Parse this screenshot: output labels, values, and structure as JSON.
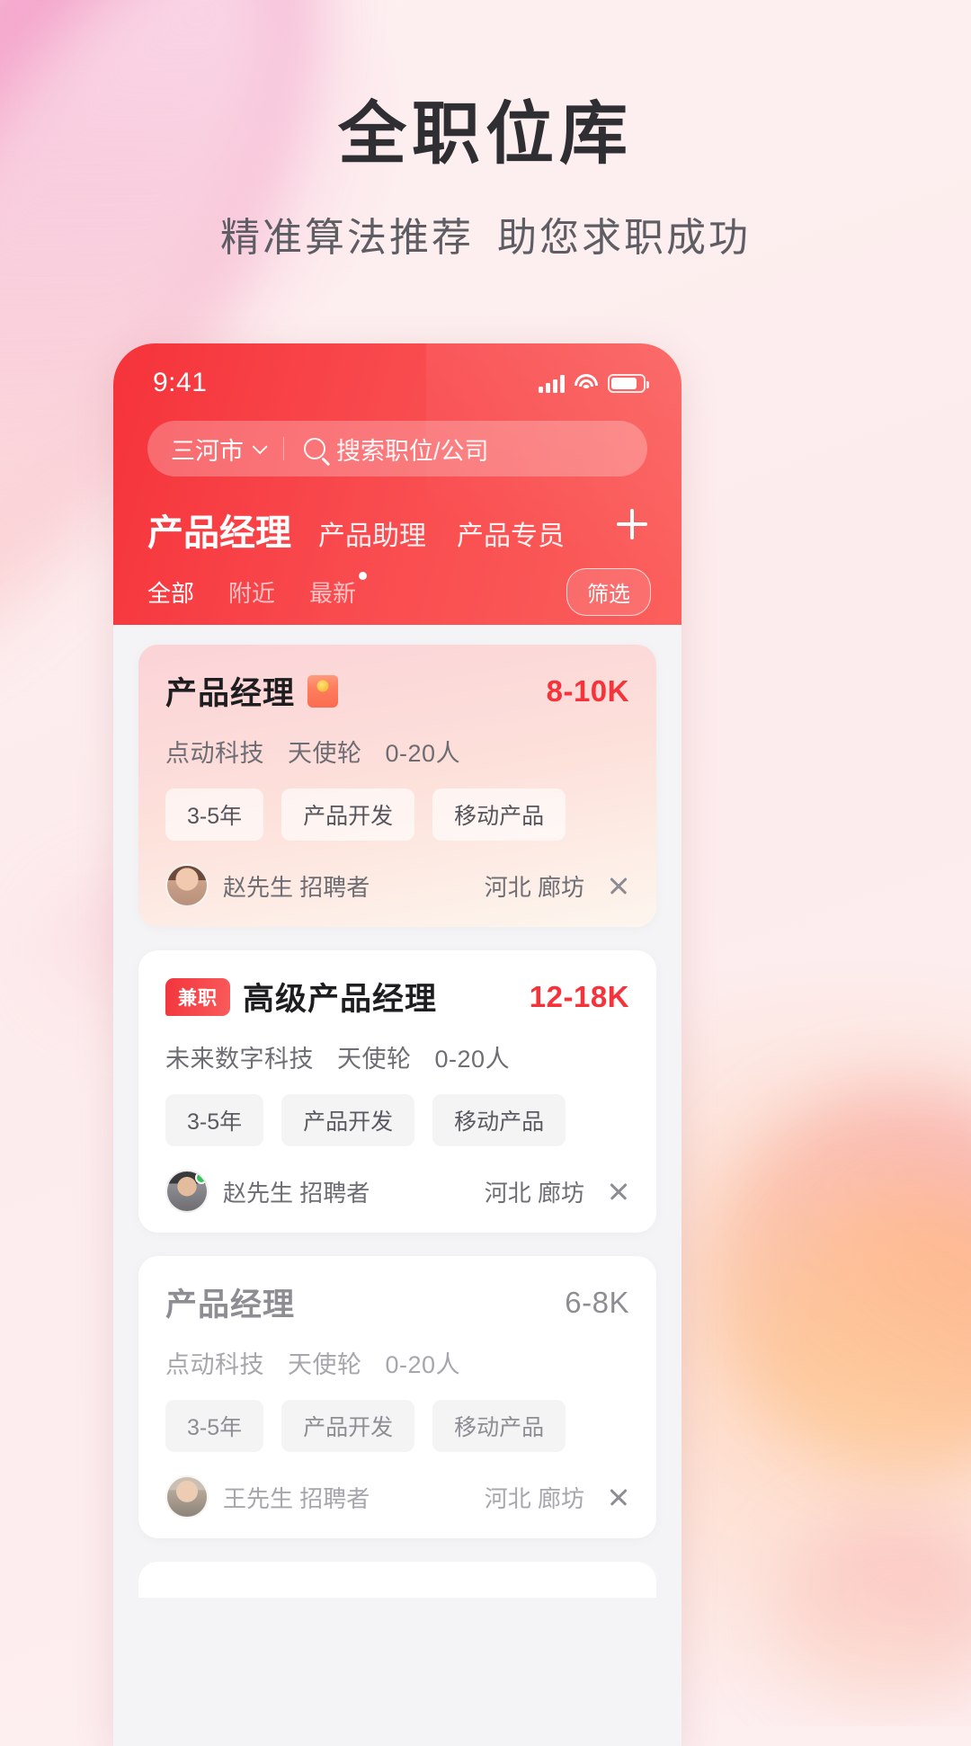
{
  "promo": {
    "title": "全职位库",
    "subtitle_left": "精准算法推荐",
    "subtitle_right": "助您求职成功"
  },
  "phone": {
    "status_bar": {
      "time": "9:41",
      "signal_icon": "signal-bars-icon",
      "wifi_icon": "wifi-icon",
      "battery_icon": "battery-icon"
    },
    "search": {
      "city": "三河市",
      "city_chevron_icon": "chevron-down-icon",
      "search_icon": "search-icon",
      "placeholder": "搜索职位/公司"
    },
    "category_tabs": [
      {
        "label": "产品经理",
        "active": true
      },
      {
        "label": "产品助理",
        "active": false
      },
      {
        "label": "产品专员",
        "active": false
      }
    ],
    "add_tab_icon": "plus-icon",
    "sub_filters": [
      {
        "label": "全部",
        "active": true,
        "badge": false
      },
      {
        "label": "附近",
        "active": false,
        "badge": false
      },
      {
        "label": "最新",
        "active": false,
        "badge": true
      }
    ],
    "filter_button": "筛选",
    "jobs": [
      {
        "title": "产品经理",
        "badge": "",
        "has_hongbao": true,
        "salary": "8-10K",
        "company": "点动科技",
        "stage": "天使轮",
        "size": "0-20人",
        "tags": [
          "3-5年",
          "产品开发",
          "移动产品"
        ],
        "recruiter": "赵先生 招聘者",
        "online": false,
        "location": "河北 廊坊",
        "close_icon": "close-icon",
        "style": "promo"
      },
      {
        "title": "高级产品经理",
        "badge": "兼职",
        "has_hongbao": false,
        "salary": "12-18K",
        "company": "未来数字科技",
        "stage": "天使轮",
        "size": "0-20人",
        "tags": [
          "3-5年",
          "产品开发",
          "移动产品"
        ],
        "recruiter": "赵先生 招聘者",
        "online": true,
        "location": "河北 廊坊",
        "close_icon": "close-icon",
        "style": "normal"
      },
      {
        "title": "产品经理",
        "badge": "",
        "has_hongbao": false,
        "salary": "6-8K",
        "company": "点动科技",
        "stage": "天使轮",
        "size": "0-20人",
        "tags": [
          "3-5年",
          "产品开发",
          "移动产品"
        ],
        "recruiter": "王先生 招聘者",
        "online": false,
        "location": "河北 廊坊",
        "close_icon": "close-icon",
        "style": "muted"
      }
    ]
  }
}
